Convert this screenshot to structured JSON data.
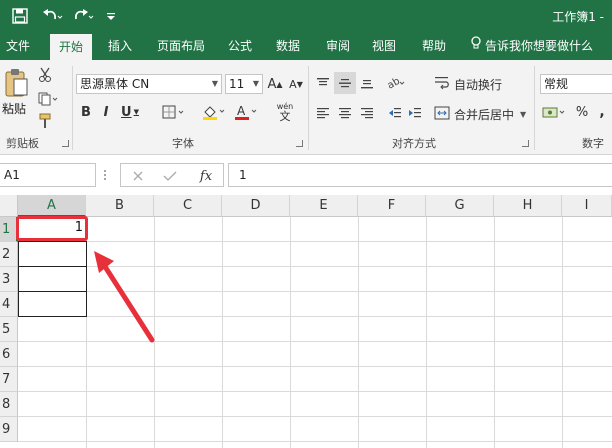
{
  "title_bar": {
    "document_title": "工作簿1 -"
  },
  "tabs": [
    {
      "label": "文件"
    },
    {
      "label": "开始"
    },
    {
      "label": "插入"
    },
    {
      "label": "页面布局"
    },
    {
      "label": "公式"
    },
    {
      "label": "数据"
    },
    {
      "label": "审阅"
    },
    {
      "label": "视图"
    },
    {
      "label": "帮助"
    }
  ],
  "tell_me": "告诉我你想要做什么",
  "ribbon": {
    "clipboard": {
      "paste_label": "粘贴",
      "group_label": "剪贴板"
    },
    "font": {
      "font_name": "思源黑体 CN",
      "font_size": "11",
      "group_label": "字体",
      "pinyin_label": "wén"
    },
    "alignment": {
      "wrap_label": "自动换行",
      "merge_label": "合并后居中",
      "group_label": "对齐方式"
    },
    "number": {
      "format": "常规",
      "group_label": "数字",
      "percent": "%",
      "comma": ","
    }
  },
  "formula_bar": {
    "name_box": "A1",
    "fx": "fx",
    "value": "1"
  },
  "sheet": {
    "columns": [
      "A",
      "B",
      "C",
      "D",
      "E",
      "F",
      "G",
      "H",
      "I"
    ],
    "rows": [
      "1",
      "2",
      "3",
      "4",
      "5",
      "6",
      "7",
      "8",
      "9"
    ],
    "a1_value": "1"
  },
  "colors": {
    "accent": "#217346",
    "highlight": "#e8303a"
  }
}
